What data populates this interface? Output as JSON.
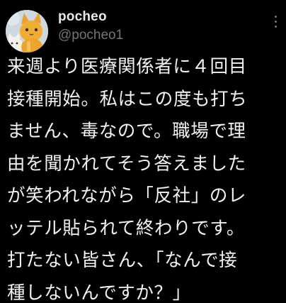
{
  "tweet": {
    "display_name": "pocheo",
    "handle": "@pocheo1",
    "body_lines": [
      "来週より医療関係者に４回目",
      "接種開始。私はこの度も打ち",
      "ません、毒なので。職場で理",
      "由を聞かれてそう答えました",
      "が笑われながら「反社」のレ",
      "ッテル貼られて終わりです。",
      "打たない皆さん、「なんで接",
      "種しないんですか？」"
    ]
  },
  "colors": {
    "background": "#000000",
    "text": "#e7e9ea",
    "secondary": "#71767b"
  },
  "icons": {
    "avatar": "cat-avatar",
    "more": "more-options-icon"
  }
}
